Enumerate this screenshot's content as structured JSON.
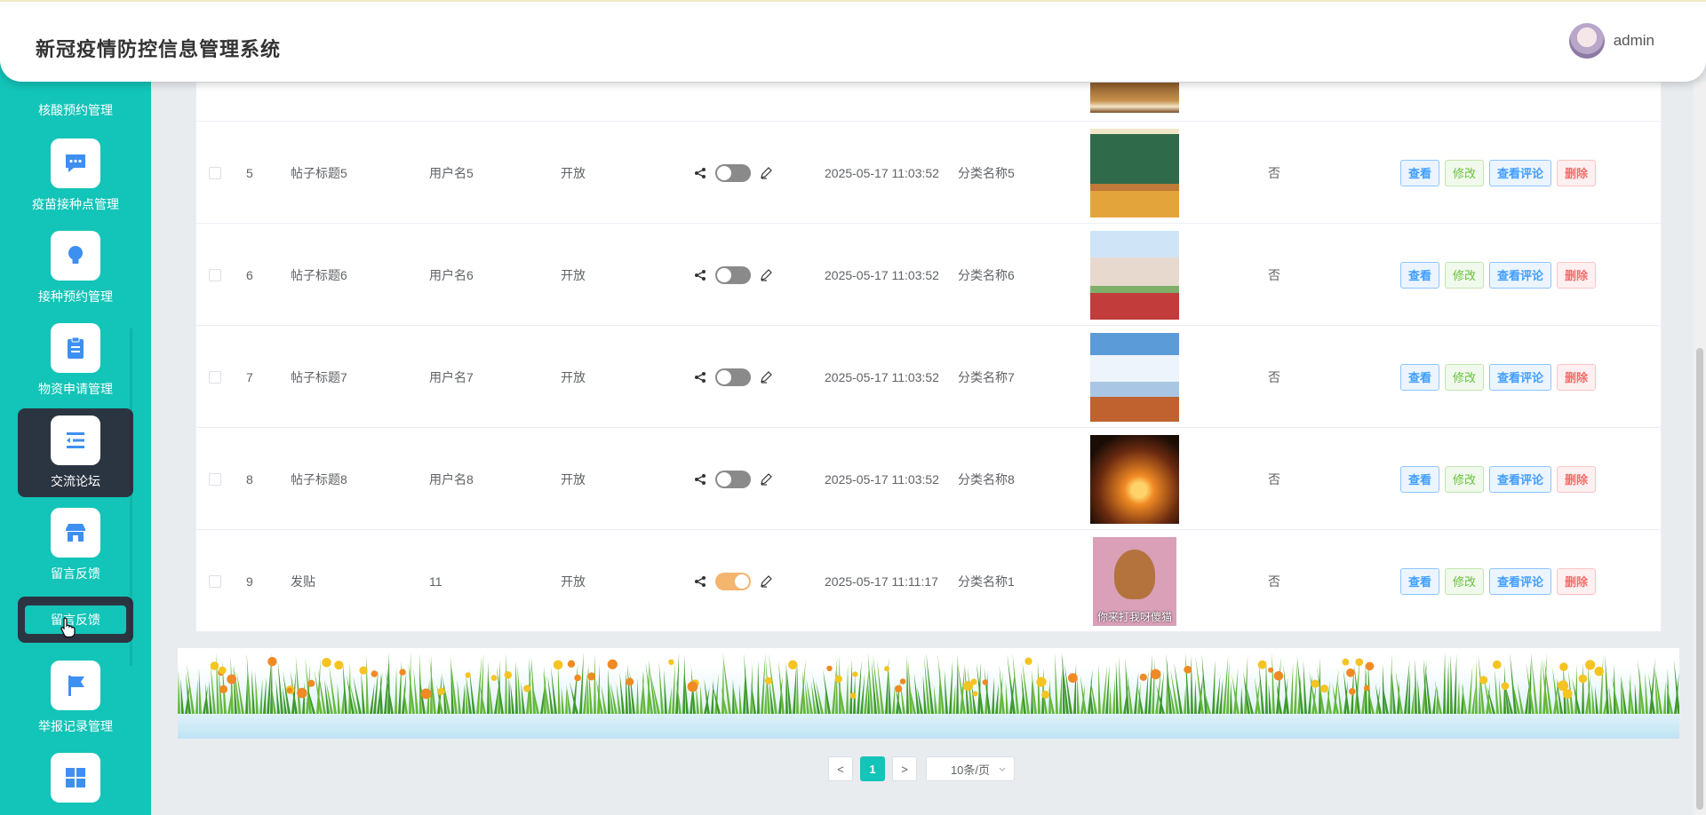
{
  "header": {
    "title": "新冠疫情防控信息管理系统",
    "username": "admin"
  },
  "sidebar": {
    "partial_label": "核酸预约管理",
    "items": [
      {
        "label": "疫苗接种点管理",
        "icon": "chat-dots-icon"
      },
      {
        "label": "接种预约管理",
        "icon": "bulb-icon"
      },
      {
        "label": "物资申请管理",
        "icon": "clipboard-icon"
      },
      {
        "label": "交流论坛",
        "icon": "list-indent-icon"
      },
      {
        "label": "留言反馈",
        "icon": "shop-icon"
      },
      {
        "label": "举报记录管理",
        "icon": "flag-icon"
      },
      {
        "label": "",
        "icon": "grid-icon"
      }
    ],
    "submenu_label": "留言反馈"
  },
  "table": {
    "rows": [
      {
        "no": "5",
        "title": "帖子标题5",
        "user": "用户名5",
        "status": "开放",
        "switch_on": false,
        "time": "2025-05-17 11:03:52",
        "category": "分类名称5",
        "image": "classroom",
        "flag": "否"
      },
      {
        "no": "6",
        "title": "帖子标题6",
        "user": "用户名6",
        "status": "开放",
        "switch_on": false,
        "time": "2025-05-17 11:03:52",
        "category": "分类名称6",
        "image": "track-building",
        "flag": "否"
      },
      {
        "no": "7",
        "title": "帖子标题7",
        "user": "用户名7",
        "status": "开放",
        "switch_on": false,
        "time": "2025-05-17 11:03:52",
        "category": "分类名称7",
        "image": "sky-track",
        "flag": "否"
      },
      {
        "no": "8",
        "title": "帖子标题8",
        "user": "用户名8",
        "status": "开放",
        "switch_on": false,
        "time": "2025-05-17 11:03:52",
        "category": "分类名称8",
        "image": "sunset-palm",
        "flag": "否"
      },
      {
        "no": "9",
        "title": "发贴",
        "user": "11",
        "status": "开放",
        "switch_on": true,
        "time": "2025-05-17 11:11:17",
        "category": "分类名称1",
        "image": "cartoon",
        "image_caption": "你来打我呀傻猫",
        "flag": "否"
      }
    ],
    "actions": {
      "view": "查看",
      "edit": "修改",
      "comments": "查看评论",
      "delete": "删除"
    }
  },
  "pagination": {
    "prev": "<",
    "current": "1",
    "next": ">",
    "page_size": "10条/页"
  },
  "colors": {
    "sidebar": "#13c4b8",
    "active": "#2b3542",
    "switch_on": "#f4b56f"
  }
}
